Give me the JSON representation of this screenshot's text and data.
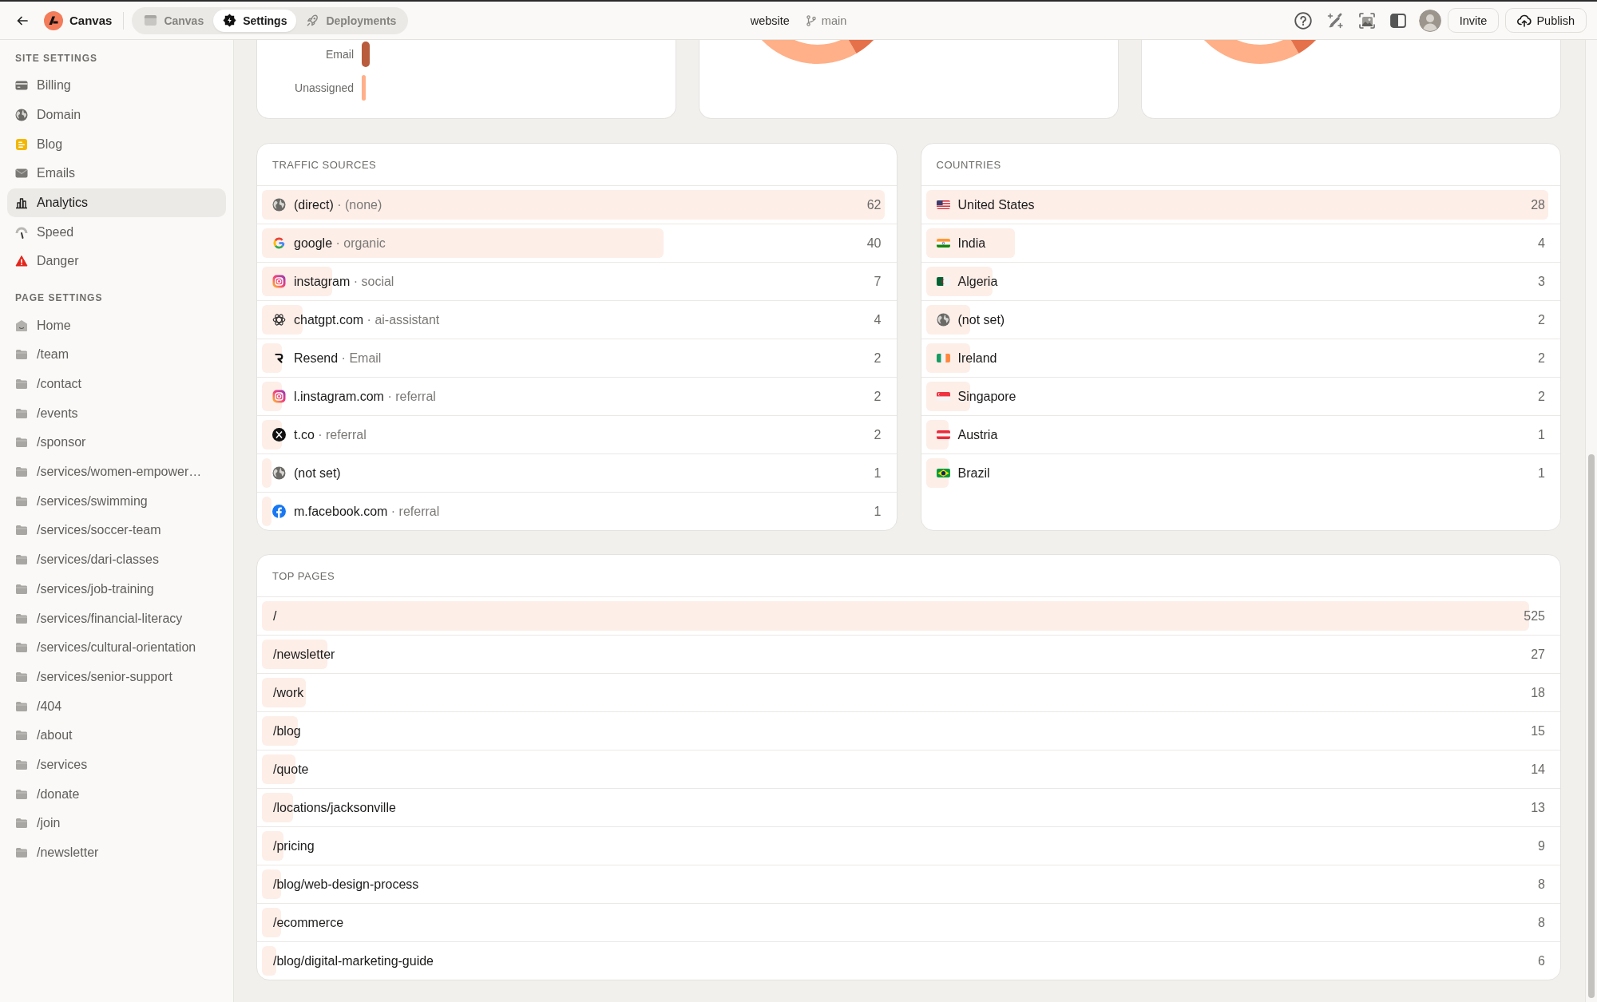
{
  "topbar": {
    "title": "Canvas",
    "tabs": [
      {
        "label": "Canvas",
        "selected": false
      },
      {
        "label": "Settings",
        "selected": true
      },
      {
        "label": "Deployments",
        "selected": false
      }
    ],
    "project": "website",
    "branch": "main",
    "buttons": [
      {
        "label": "Invite",
        "kind": "plain"
      },
      {
        "label": "Publish",
        "kind": "upload"
      }
    ]
  },
  "sidebar": {
    "sections": [
      {
        "heading": "SITE SETTINGS",
        "items": [
          {
            "label": "Billing",
            "selected": false
          },
          {
            "label": "Domain",
            "selected": false
          },
          {
            "label": "Blog",
            "selected": false
          },
          {
            "label": "Emails",
            "selected": false
          },
          {
            "label": "Analytics",
            "selected": true
          },
          {
            "label": "Speed",
            "selected": false
          },
          {
            "label": "Danger",
            "selected": false
          }
        ]
      },
      {
        "heading": "PAGE SETTINGS",
        "items": [
          {
            "label": "Home",
            "selected": false
          },
          {
            "label": "/team",
            "selected": false
          },
          {
            "label": "/contact",
            "selected": false
          },
          {
            "label": "/events",
            "selected": false
          },
          {
            "label": "/sponsor",
            "selected": false
          },
          {
            "label": "/services/women-empower…",
            "selected": false
          },
          {
            "label": "/services/swimming",
            "selected": false
          },
          {
            "label": "/services/soccer-team",
            "selected": false
          },
          {
            "label": "/services/dari-classes",
            "selected": false
          },
          {
            "label": "/services/job-training",
            "selected": false
          },
          {
            "label": "/services/financial-literacy",
            "selected": false
          },
          {
            "label": "/services/cultural-orientation",
            "selected": false
          },
          {
            "label": "/services/senior-support",
            "selected": false
          },
          {
            "label": "/404",
            "selected": false
          },
          {
            "label": "/about",
            "selected": false
          },
          {
            "label": "/services",
            "selected": false
          },
          {
            "label": "/donate",
            "selected": false
          },
          {
            "label": "/join",
            "selected": false
          },
          {
            "label": "/newsletter",
            "selected": false
          }
        ]
      }
    ]
  },
  "card_1": {
    "rows": [
      {
        "label": "Email",
        "color": "#b95b3d"
      },
      {
        "label": "Unassigned",
        "color": "#ffb08a"
      }
    ]
  },
  "traffic_sources": {
    "heading": "TRAFFIC SOURCES",
    "rows": [
      {
        "name": "(direct)",
        "channel": "· (none)",
        "count": "62",
        "level": 1
      },
      {
        "name": "google",
        "channel": "· organic",
        "count": "40",
        "level": 0.645
      },
      {
        "name": "instagram",
        "channel": "· social",
        "count": "7",
        "level": 0.113
      },
      {
        "name": "chatgpt.com",
        "channel": "· ai-assistant",
        "count": "4",
        "level": 0.065
      },
      {
        "name": "Resend",
        "channel": "· Email",
        "count": "2",
        "level": 0.032
      },
      {
        "name": "l.instagram.com",
        "channel": "· referral",
        "count": "2",
        "level": 0.032
      },
      {
        "name": "t.co",
        "channel": "· referral",
        "count": "2",
        "level": 0.032
      },
      {
        "name": "(not set)",
        "count": "1",
        "level": 0.016
      },
      {
        "name": "m.facebook.com",
        "channel": "· referral",
        "count": "1",
        "level": 0.016
      }
    ]
  },
  "countries": {
    "heading": "COUNTRIES",
    "rows": [
      {
        "name": "United States",
        "count": "28",
        "level": 1
      },
      {
        "name": "India",
        "count": "4",
        "level": 0.143
      },
      {
        "name": "Algeria",
        "count": "3",
        "level": 0.107
      },
      {
        "name": "(not set)",
        "count": "2",
        "level": 0.071
      },
      {
        "name": "Ireland",
        "count": "2",
        "level": 0.071
      },
      {
        "name": "Singapore",
        "count": "2",
        "level": 0.071
      },
      {
        "name": "Austria",
        "count": "1",
        "level": 0.036
      },
      {
        "name": "Brazil",
        "count": "1",
        "level": 0.036
      }
    ]
  },
  "top_pages": {
    "heading": "TOP PAGES",
    "rows": [
      {
        "path": "/",
        "count": "525",
        "level": 0.985
      },
      {
        "path": "/newsletter",
        "count": "27",
        "level": 0.051
      },
      {
        "path": "/work",
        "count": "18",
        "level": 0.034
      },
      {
        "path": "/blog",
        "count": "15",
        "level": 0.028
      },
      {
        "path": "/quote",
        "count": "14",
        "level": 0.026
      },
      {
        "path": "/locations/jacksonville",
        "count": "13",
        "level": 0.024
      },
      {
        "path": "/pricing",
        "count": "9",
        "level": 0.017
      },
      {
        "path": "/blog/web-design-process",
        "count": "8",
        "level": 0.015
      },
      {
        "path": "/ecommerce",
        "count": "8",
        "level": 0.015
      },
      {
        "path": "/blog/digital-marketing-guide",
        "count": "6",
        "level": 0.011
      }
    ]
  }
}
